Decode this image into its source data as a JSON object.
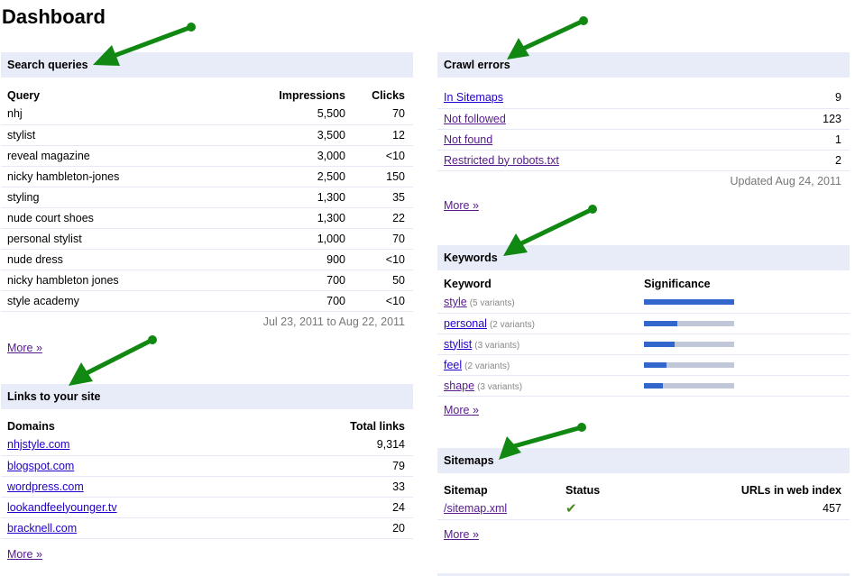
{
  "page": {
    "title": "Dashboard"
  },
  "colors": {
    "header_bg": "#e8ecf8",
    "link": "#2200cc",
    "visited_link": "#551a8b",
    "bar_fill": "#3366cc",
    "bar_track": "#c0c7d8",
    "arrow": "#118811"
  },
  "search_queries": {
    "title": "Search queries",
    "columns": [
      "Query",
      "Impressions",
      "Clicks"
    ],
    "rows": [
      {
        "query": "nhj",
        "impressions": "5,500",
        "clicks": "70"
      },
      {
        "query": "stylist",
        "impressions": "3,500",
        "clicks": "12"
      },
      {
        "query": "reveal magazine",
        "impressions": "3,000",
        "clicks": "<10"
      },
      {
        "query": "nicky hambleton-jones",
        "impressions": "2,500",
        "clicks": "150"
      },
      {
        "query": "styling",
        "impressions": "1,300",
        "clicks": "35"
      },
      {
        "query": "nude court shoes",
        "impressions": "1,300",
        "clicks": "22"
      },
      {
        "query": "personal stylist",
        "impressions": "1,000",
        "clicks": "70"
      },
      {
        "query": "nude dress",
        "impressions": "900",
        "clicks": "<10"
      },
      {
        "query": "nicky hambleton jones",
        "impressions": "700",
        "clicks": "50"
      },
      {
        "query": "style academy",
        "impressions": "700",
        "clicks": "<10"
      }
    ],
    "date_range": "Jul 23, 2011 to Aug 22, 2011",
    "more_label": "More »"
  },
  "links": {
    "title": "Links to your site",
    "columns": [
      "Domains",
      "Total links"
    ],
    "rows": [
      {
        "domain": "nhjstyle.com",
        "total": "9,314"
      },
      {
        "domain": "blogspot.com",
        "total": "79"
      },
      {
        "domain": "wordpress.com",
        "total": "33"
      },
      {
        "domain": "lookandfeelyounger.tv",
        "total": "24"
      },
      {
        "domain": "bracknell.com",
        "total": "20"
      }
    ],
    "more_label": "More »"
  },
  "crawl_errors": {
    "title": "Crawl errors",
    "rows": [
      {
        "label": "In Sitemaps",
        "count": "9"
      },
      {
        "label": "Not followed",
        "count": "123"
      },
      {
        "label": "Not found",
        "count": "1"
      },
      {
        "label": "Restricted by robots.txt",
        "count": "2"
      }
    ],
    "updated": "Updated Aug 24, 2011",
    "more_label": "More »"
  },
  "keywords": {
    "title": "Keywords",
    "columns": [
      "Keyword",
      "Significance"
    ],
    "rows": [
      {
        "keyword": "style",
        "variants": "(5 variants)",
        "significance": 1.0
      },
      {
        "keyword": "personal",
        "variants": "(2 variants)",
        "significance": 0.37
      },
      {
        "keyword": "stylist",
        "variants": "(3 variants)",
        "significance": 0.34
      },
      {
        "keyword": "feel",
        "variants": "(2 variants)",
        "significance": 0.25
      },
      {
        "keyword": "shape",
        "variants": "(3 variants)",
        "significance": 0.21
      }
    ],
    "more_label": "More »"
  },
  "sitemaps": {
    "title": "Sitemaps",
    "columns": [
      "Sitemap",
      "Status",
      "URLs in web index"
    ],
    "rows": [
      {
        "sitemap": "/sitemap.xml",
        "status_icon": "check-icon",
        "status_glyph": "✔",
        "urls": "457"
      }
    ],
    "more_label": "More »"
  }
}
